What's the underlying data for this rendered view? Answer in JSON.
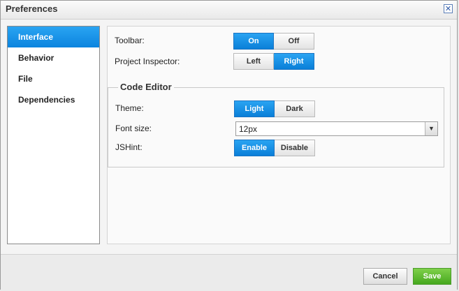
{
  "dialog": {
    "title": "Preferences",
    "close_glyph": "✕",
    "close_icon": "close-icon"
  },
  "sidebar": {
    "items": [
      {
        "label": "Interface",
        "active": true
      },
      {
        "label": "Behavior",
        "active": false
      },
      {
        "label": "File",
        "active": false
      },
      {
        "label": "Dependencies",
        "active": false
      }
    ]
  },
  "interface": {
    "toolbar": {
      "label": "Toolbar:",
      "options": [
        "On",
        "Off"
      ],
      "selected": "On"
    },
    "project_inspector": {
      "label": "Project Inspector:",
      "options": [
        "Left",
        "Right"
      ],
      "selected": "Right"
    }
  },
  "code_editor": {
    "legend": "Code Editor",
    "theme": {
      "label": "Theme:",
      "options": [
        "Light",
        "Dark"
      ],
      "selected": "Light"
    },
    "font_size": {
      "label": "Font size:",
      "value": "12px"
    },
    "jshint": {
      "label": "JSHint:",
      "options": [
        "Enable",
        "Disable"
      ],
      "selected": "Enable"
    }
  },
  "footer": {
    "cancel_label": "Cancel",
    "save_label": "Save"
  },
  "colors": {
    "accent": "#0c84de",
    "save": "#46a81e"
  }
}
